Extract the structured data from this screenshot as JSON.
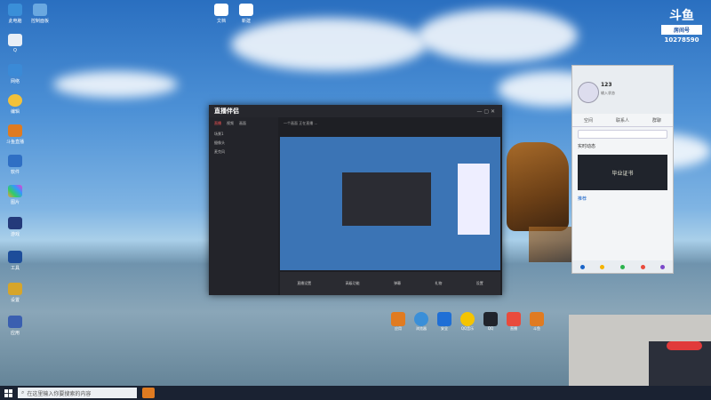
{
  "desktop": {
    "icons": [
      {
        "label": "此电脑"
      },
      {
        "label": "控制面板"
      },
      {
        "label": "Q"
      },
      {
        "label": "网络"
      },
      {
        "label": "编辑"
      },
      {
        "label": "斗鱼直播"
      },
      {
        "label": "软件"
      },
      {
        "label": "图片"
      },
      {
        "label": "游戏"
      },
      {
        "label": "工具"
      },
      {
        "label": "设置"
      },
      {
        "label": "应用"
      }
    ],
    "top_files": [
      "文档",
      "新建"
    ]
  },
  "brand": {
    "name": "斗鱼",
    "sub": "房间号",
    "room_id": "10278590"
  },
  "taskbar": {
    "search_placeholder": "在这里输入你要搜索的内容"
  },
  "recorder": {
    "title": "直播伴侣",
    "tabs": [
      "直播",
      "视频",
      "画面"
    ],
    "side_items": [
      "场景1",
      "摄像头",
      "麦克风"
    ],
    "bottom_items": [
      "直播设置",
      "高级功能",
      "弹幕",
      "礼物",
      "设置"
    ],
    "top_notice": "一个画面 正在直播 ..."
  },
  "chat": {
    "nickname": "123",
    "status": "输入状态",
    "tabs": [
      "空间",
      "联系人",
      "群聊"
    ],
    "card_text": "毕业证书",
    "item": "实时动态",
    "recommend": "推荐"
  },
  "dock": [
    "应用",
    "浏览器",
    "安全",
    "QQ音乐",
    "QQ",
    "直播",
    "斗鱼"
  ]
}
